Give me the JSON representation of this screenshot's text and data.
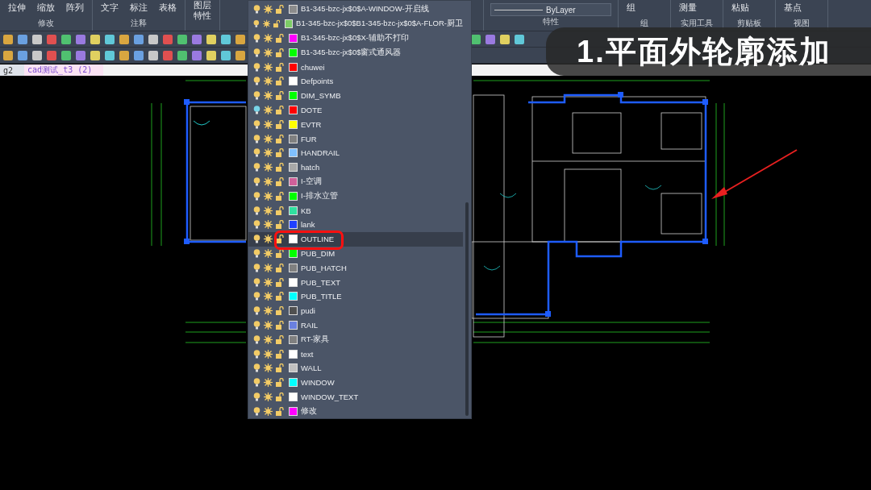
{
  "ribbon": {
    "panels": [
      {
        "label": "修改",
        "commands": [
          "拉伸",
          "缩放",
          "阵列"
        ]
      },
      {
        "label": "注释",
        "commands": [
          "文字",
          "标注",
          "表格"
        ]
      },
      {
        "commands": [
          "图层特性"
        ]
      }
    ],
    "linetype": "ByLayer",
    "properties_label": "特性",
    "right_panels": [
      {
        "label": "组",
        "command": "组"
      },
      {
        "label": "实用工具",
        "command": "测量"
      },
      {
        "label": "剪贴板",
        "command": "粘贴"
      },
      {
        "label": "视图",
        "command": "基点"
      }
    ]
  },
  "tabs": [
    {
      "label": "g2",
      "selected": false
    },
    {
      "label": "cad测试_t3 (2)",
      "selected": true
    }
  ],
  "layers": [
    {
      "name": "B1-345-bzc-jx$0$A-WINDOW-开启线",
      "color": "#8c8c8c",
      "on": true,
      "selected": false
    },
    {
      "name": "B1-345-bzc-jx$0$B1-345-bzc-jx$0$A-FLOR-厨卫",
      "color": "#7ccc66",
      "on": true,
      "selected": false
    },
    {
      "name": "B1-345-bzc-jx$0$X-辅助不打印",
      "color": "#ff00ff",
      "on": true,
      "selected": false
    },
    {
      "name": "B1-345-bzc-jx$0$窗式通风器",
      "color": "#00ff00",
      "on": true,
      "selected": false
    },
    {
      "name": "chuwei",
      "color": "#ff0000",
      "on": true,
      "selected": false
    },
    {
      "name": "Defpoints",
      "color": "#ffffff",
      "on": true,
      "selected": false
    },
    {
      "name": "DIM_SYMB",
      "color": "#00ff00",
      "on": true,
      "selected": false
    },
    {
      "name": "DOTE",
      "color": "#ff0000",
      "on": false,
      "selected": false
    },
    {
      "name": "EVTR",
      "color": "#ffff00",
      "on": true,
      "selected": false
    },
    {
      "name": "FUR",
      "color": "#808080",
      "on": true,
      "selected": false
    },
    {
      "name": "HANDRAIL",
      "color": "#80c0ff",
      "on": true,
      "selected": false
    },
    {
      "name": "hatch",
      "color": "#a8a8a8",
      "on": true,
      "selected": false
    },
    {
      "name": "I-空调",
      "color": "#d0609a",
      "on": true,
      "selected": false
    },
    {
      "name": "I-排水立管",
      "color": "#00ff00",
      "on": true,
      "selected": false
    },
    {
      "name": "KB",
      "color": "#30e0a0",
      "on": true,
      "selected": false
    },
    {
      "name": "lank",
      "color": "#2040ff",
      "on": true,
      "selected": false
    },
    {
      "name": "OUTLINE",
      "color": "#ffffff",
      "on": true,
      "selected": true
    },
    {
      "name": "PUB_DIM",
      "color": "#00ff00",
      "on": true,
      "selected": false
    },
    {
      "name": "PUB_HATCH",
      "color": "#808080",
      "on": true,
      "selected": false
    },
    {
      "name": "PUB_TEXT",
      "color": "#ffffff",
      "on": true,
      "selected": false
    },
    {
      "name": "PUB_TITLE",
      "color": "#00ffff",
      "on": true,
      "selected": false
    },
    {
      "name": "pudi",
      "color": "#505050",
      "on": true,
      "selected": false
    },
    {
      "name": "RAIL",
      "color": "#6a80e0",
      "on": true,
      "selected": false
    },
    {
      "name": "RT-家具",
      "color": "#808080",
      "on": true,
      "selected": false
    },
    {
      "name": "text",
      "color": "#ffffff",
      "on": true,
      "selected": false
    },
    {
      "name": "WALL",
      "color": "#c0c0c0",
      "on": true,
      "selected": false
    },
    {
      "name": "WINDOW",
      "color": "#00ffff",
      "on": true,
      "selected": false
    },
    {
      "name": "WINDOW_TEXT",
      "color": "#ffffff",
      "on": true,
      "selected": false
    },
    {
      "name": "修改",
      "color": "#ff00ff",
      "on": true,
      "selected": false
    }
  ],
  "caption": "1.平面外轮廓添加"
}
